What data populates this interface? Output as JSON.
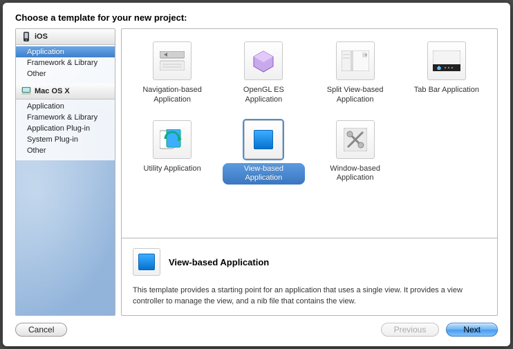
{
  "title": "Choose a template for your new project:",
  "sidebar": {
    "sections": [
      {
        "icon": "device-icon",
        "label": "iOS",
        "items": [
          {
            "label": "Application",
            "selected": true
          },
          {
            "label": "Framework & Library"
          },
          {
            "label": "Other"
          }
        ]
      },
      {
        "icon": "mac-icon",
        "label": "Mac OS X",
        "items": [
          {
            "label": "Application"
          },
          {
            "label": "Framework & Library"
          },
          {
            "label": "Application Plug-in"
          },
          {
            "label": "System Plug-in"
          },
          {
            "label": "Other"
          }
        ]
      }
    ]
  },
  "templates": [
    {
      "icon": "navigation-icon",
      "label": "Navigation-based Application"
    },
    {
      "icon": "opengl-icon",
      "label": "OpenGL ES Application"
    },
    {
      "icon": "splitview-icon",
      "label": "Split View-based Application"
    },
    {
      "icon": "tabbar-icon",
      "label": "Tab Bar Application"
    },
    {
      "icon": "utility-icon",
      "label": "Utility Application"
    },
    {
      "icon": "view-icon",
      "label": "View-based Application",
      "selected": true
    },
    {
      "icon": "window-icon",
      "label": "Window-based Application"
    }
  ],
  "detail": {
    "icon": "view-icon",
    "title": "View-based Application",
    "description": "This template provides a starting point for an application that uses a single view. It provides a view controller to manage the view, and a nib file that contains the view."
  },
  "buttons": {
    "cancel": "Cancel",
    "previous": "Previous",
    "next": "Next"
  }
}
